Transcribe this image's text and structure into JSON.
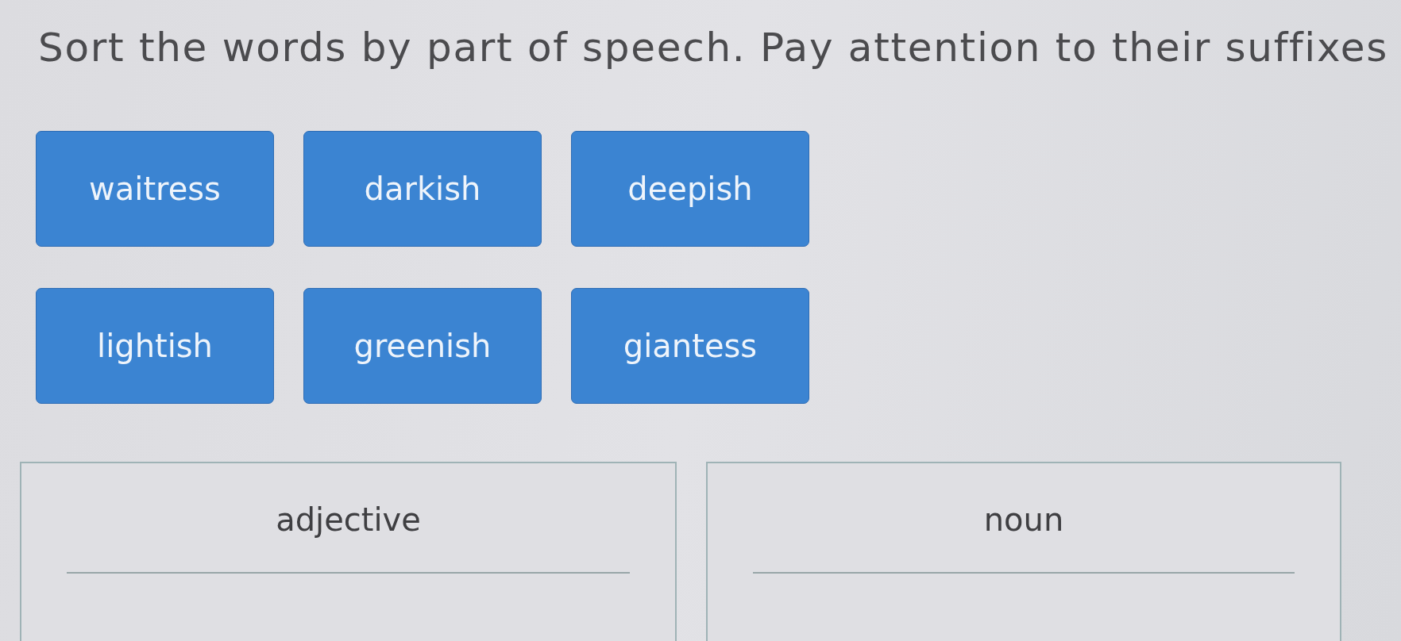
{
  "instruction": "Sort the words by part of speech. Pay attention to their suffixes",
  "word_tiles": [
    {
      "label": "waitress"
    },
    {
      "label": "darkish"
    },
    {
      "label": "deepish"
    },
    {
      "label": "lightish"
    },
    {
      "label": "greenish"
    },
    {
      "label": "giantess"
    }
  ],
  "categories": [
    {
      "label": "adjective"
    },
    {
      "label": "noun"
    }
  ]
}
